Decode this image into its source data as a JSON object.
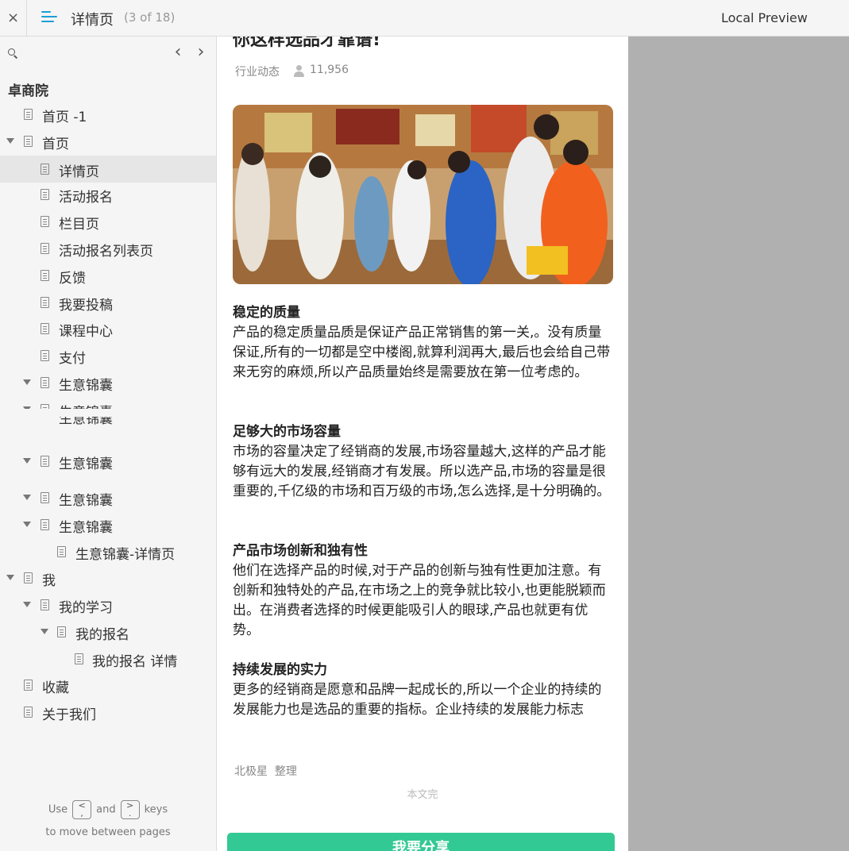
{
  "topbar": {
    "close_glyph": "×",
    "title": "详情页",
    "page_count": "(3 of 18)",
    "preview_label": "Local Preview"
  },
  "sidebar": {
    "project_name": "卓商院",
    "prev_glyph": "‹",
    "next_glyph": "›",
    "items": [
      {
        "label": "首页 -1"
      },
      {
        "label": "首页"
      },
      {
        "label": "详情页"
      },
      {
        "label": "活动报名"
      },
      {
        "label": "栏目页"
      },
      {
        "label": "活动报名列表页"
      },
      {
        "label": "反馈"
      },
      {
        "label": "我要投稿"
      },
      {
        "label": "课程中心"
      },
      {
        "label": "支付"
      },
      {
        "label": "生意锦囊"
      },
      {
        "label": "生意锦囊"
      },
      {
        "label": "生意锦囊"
      },
      {
        "label": "生意锦囊"
      },
      {
        "label": "生意锦囊"
      },
      {
        "label": "生意锦囊"
      },
      {
        "label": "生意锦囊-详情页"
      },
      {
        "label": "我"
      },
      {
        "label": "我的学习"
      },
      {
        "label": "我的报名"
      },
      {
        "label": "我的报名 详情"
      },
      {
        "label": "收藏"
      },
      {
        "label": "关于我们"
      }
    ],
    "hint": {
      "use": "Use",
      "key_prev": "<\n,",
      "and": "and",
      "key_next": ">\n.",
      "keys": "keys",
      "line2": "to move between pages"
    }
  },
  "article": {
    "title": "你这样选品才靠谱!",
    "category": "行业动态",
    "views": "11,956",
    "sections": [
      {
        "heading": "稳定的质量",
        "body": "产品的稳定质量品质是保证产品正常销售的第一关,。没有质量保证,所有的一切都是空中楼阁,就算利润再大,最后也会给自己带来无穷的麻烦,所以产品质量始终是需要放在第一位考虑的。"
      },
      {
        "heading": "足够大的市场容量",
        "body": "市场的容量决定了经销商的发展,市场容量越大,这样的产品才能够有远大的发展,经销商才有发展。所以选产品,市场的容量是很重要的,千亿级的市场和百万级的市场,怎么选择,是十分明确的。"
      },
      {
        "heading": "产品市场创新和独有性",
        "body": "他们在选择产品的时候,对于产品的创新与独有性更加注意。有创新和独特处的产品,在市场之上的竞争就比较小,也更能脱颖而出。在消费者选择的时候更能吸引人的眼球,产品也就更有优势。"
      },
      {
        "heading": "持续发展的实力",
        "body": "更多的经销商是愿意和品牌一起成长的,所以一个企业的持续的发展能力也是选品的重要的指标。企业持续的发展能力标志"
      }
    ],
    "author": "北极星  整理",
    "end_mark": "本文完",
    "share_label": "我要分享"
  },
  "colors": {
    "accent_blue": "#1a9ed9",
    "share_green": "#33c994",
    "preview_gray": "#b0b0b0"
  }
}
